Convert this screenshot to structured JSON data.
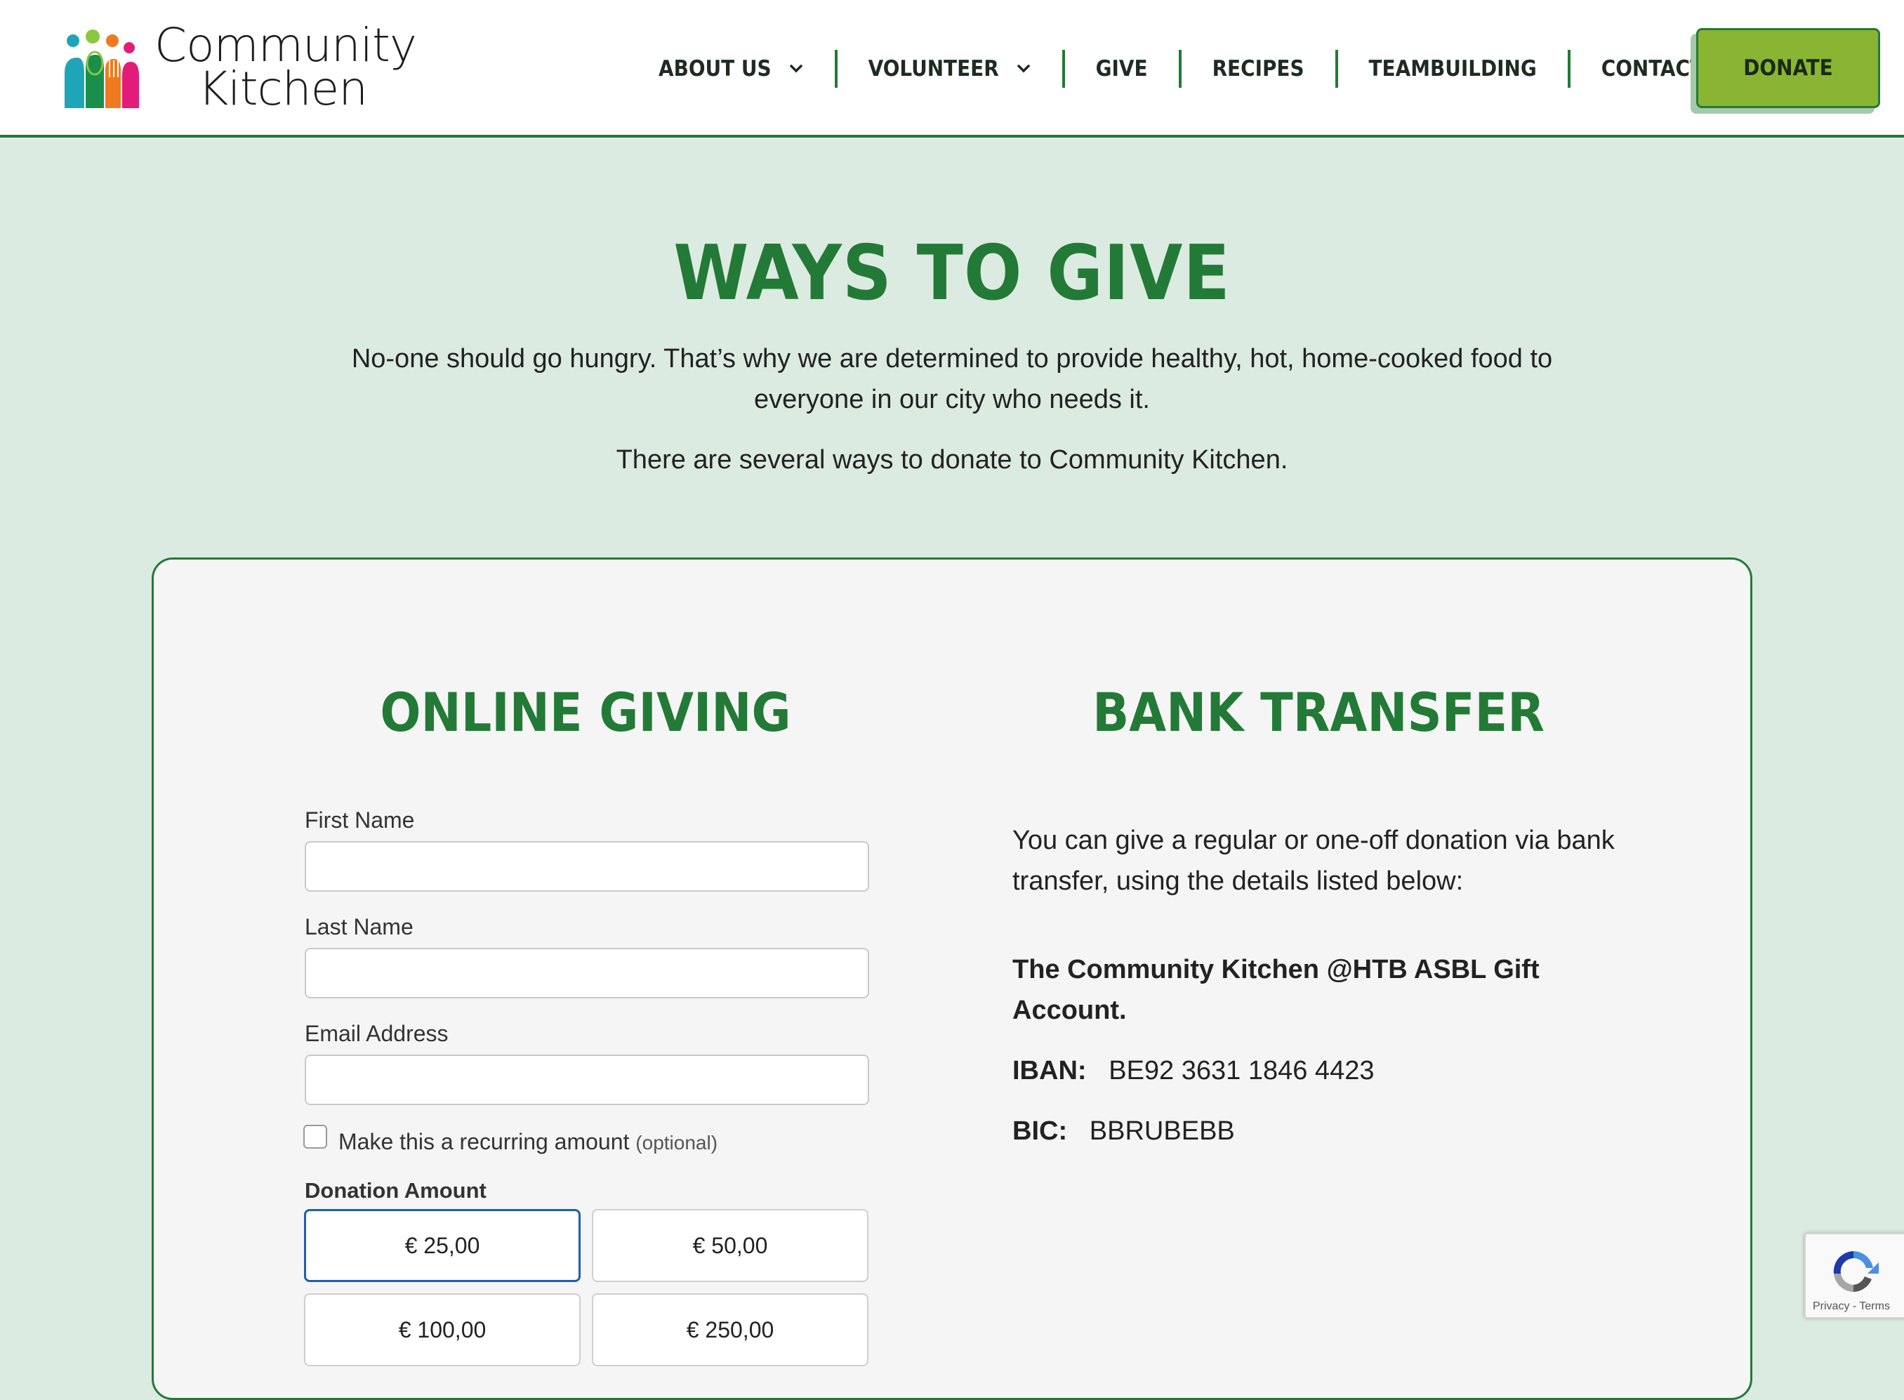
{
  "brand": {
    "name_line1": "Community",
    "name_line2": "Kitchen",
    "logo_colors": [
      "#1fa5b8",
      "#8dc63f",
      "#f07a1f",
      "#e31c79",
      "#1a8f4c"
    ]
  },
  "nav": {
    "items": [
      {
        "label": "ABOUT US",
        "has_dropdown": true
      },
      {
        "label": "VOLUNTEER",
        "has_dropdown": true
      },
      {
        "label": "GIVE",
        "has_dropdown": false
      },
      {
        "label": "RECIPES",
        "has_dropdown": false
      },
      {
        "label": "TEAMBUILDING",
        "has_dropdown": false
      },
      {
        "label": "CONTACT",
        "has_dropdown": false
      }
    ],
    "donate_label": "DONATE"
  },
  "hero": {
    "title": "WAYS TO GIVE",
    "intro": "No-one should go hungry. That’s why we are determined to provide healthy, hot, home-cooked food to everyone in our city who needs it.",
    "intro2": "There are several ways to donate to Community Kitchen."
  },
  "online": {
    "title": "ONLINE GIVING",
    "first_name_label": "First Name",
    "first_name_value": "",
    "last_name_label": "Last Name",
    "last_name_value": "",
    "email_label": "Email Address",
    "email_value": "",
    "recurring_label": "Make this a recurring amount",
    "recurring_optional": "(optional)",
    "recurring_checked": false,
    "amount_label": "Donation Amount",
    "amounts": [
      "€ 25,00",
      "€ 50,00",
      "€ 100,00",
      "€ 250,00"
    ],
    "selected_amount": "€ 25,00"
  },
  "bank": {
    "title": "BANK TRANSFER",
    "description": "You can give a regular or one-off donation via bank transfer, using the details listed below:",
    "account_name": "The Community Kitchen @HTB ASBL Gift Account.",
    "iban_label": "IBAN:",
    "iban_value": "BE92 3631 1846 4423",
    "bic_label": "BIC:",
    "bic_value": "BBRUBEBB"
  },
  "recaptcha": {
    "links": "Privacy - Terms"
  },
  "colors": {
    "accent_green": "#237a36",
    "donate_green": "#8ab533",
    "page_bg": "#dcebe1",
    "card_bg": "#f5f5f5",
    "selected_border": "#1f5fae"
  }
}
